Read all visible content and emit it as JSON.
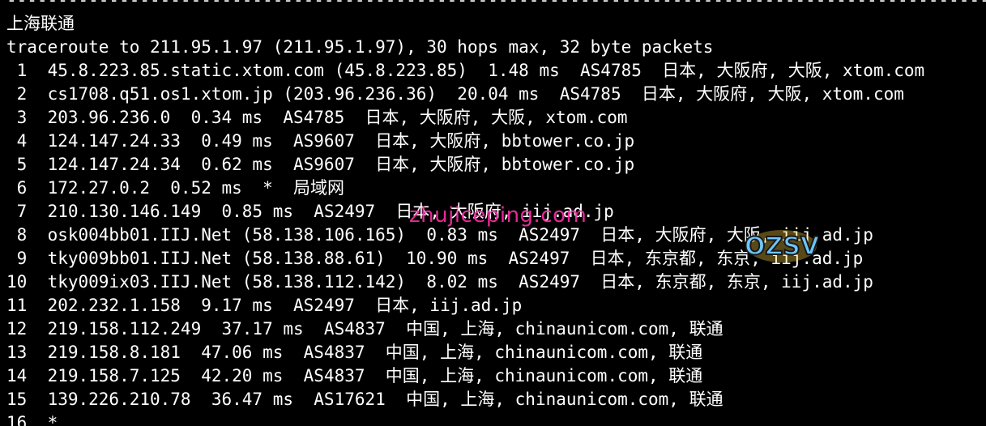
{
  "separator": "--------------------------------------------------------------------------------------------------",
  "section_title": "上海联通",
  "header": "traceroute to 211.95.1.97 (211.95.1.97), 30 hops max, 32 byte packets",
  "hops": [
    " 1  45.8.223.85.static.xtom.com (45.8.223.85)  1.48 ms  AS4785  日本, 大阪府, 大阪, xtom.com",
    " 2  cs1708.q51.os1.xtom.jp (203.96.236.36)  20.04 ms  AS4785  日本, 大阪府, 大阪, xtom.com",
    " 3  203.96.236.0  0.34 ms  AS4785  日本, 大阪府, 大阪, xtom.com",
    " 4  124.147.24.33  0.49 ms  AS9607  日本, 大阪府, bbtower.co.jp",
    " 5  124.147.24.34  0.62 ms  AS9607  日本, 大阪府, bbtower.co.jp",
    " 6  172.27.0.2  0.52 ms  *  局域网",
    " 7  210.130.146.149  0.85 ms  AS2497  日本, 大阪府, iij.ad.jp",
    " 8  osk004bb01.IIJ.Net (58.138.106.165)  0.83 ms  AS2497  日本, 大阪府, 大阪, iij.ad.jp",
    " 9  tky009bb01.IIJ.Net (58.138.88.61)  10.90 ms  AS2497  日本, 东京都, 东京, iij.ad.jp",
    "10  tky009ix03.IIJ.Net (58.138.112.142)  8.02 ms  AS2497  日本, 东京都, 东京, iij.ad.jp",
    "11  202.232.1.158  9.17 ms  AS2497  日本, iij.ad.jp",
    "12  219.158.112.249  37.17 ms  AS4837  中国, 上海, chinaunicom.com, 联通",
    "13  219.158.8.181  47.06 ms  AS4837  中国, 上海, chinaunicom.com, 联通",
    "14  219.158.7.125  42.20 ms  AS4837  中国, 上海, chinaunicom.com, 联通",
    "15  139.226.210.78  36.47 ms  AS17621  中国, 上海, chinaunicom.com, 联通",
    "16  *"
  ],
  "watermark_text": "zhujiceping.com",
  "logo_text": "OZSV",
  "colors": {
    "background": "#000000",
    "foreground": "#ffffff",
    "watermark": "#ff2fa8",
    "logo_fill": "#6ec6ff",
    "logo_outline": "#1a1a1a",
    "logo_accent": "#ffd23f"
  }
}
